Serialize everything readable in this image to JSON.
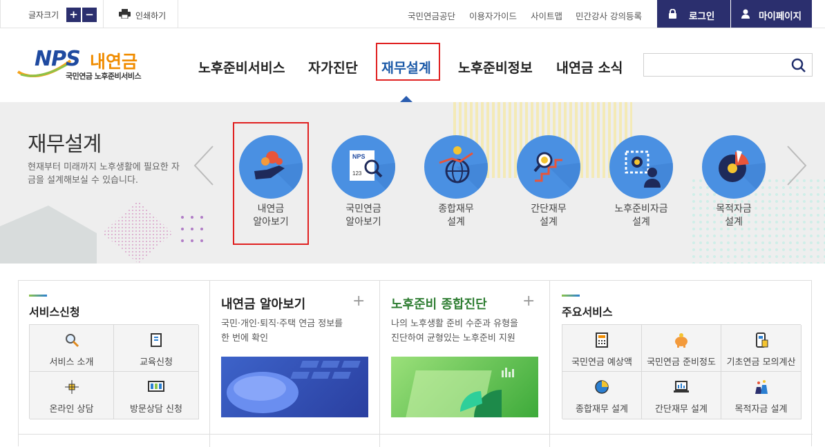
{
  "utility": {
    "font_size_label": "글자크기",
    "plus": "+",
    "minus": "−",
    "print_label": "인쇄하기",
    "links": [
      "국민연금공단",
      "이용자가이드",
      "사이트맵",
      "민간강사 강의등록"
    ],
    "login": "로그인",
    "mypage": "마이페이지"
  },
  "header": {
    "logo_main": "NPS",
    "logo_sub": "내연금",
    "logo_caption": "국민연금 노후준비서비스",
    "nav": [
      "노후준비서비스",
      "자가진단",
      "재무설계",
      "노후준비정보",
      "내연금 소식"
    ],
    "active_index": 2,
    "search_placeholder": ""
  },
  "banner": {
    "title": "재무설계",
    "desc": "현재부터 미래까지 노후생활에 필요한 자금을 설계해보실 수 있습니다.",
    "items": [
      {
        "line1": "내연금",
        "line2": "알아보기",
        "icon": "hand-coin-icon"
      },
      {
        "line1": "국민연금",
        "line2": "알아보기",
        "icon": "nps-document-search-icon"
      },
      {
        "line1": "종합재무",
        "line2": "설계",
        "icon": "globe-chart-icon"
      },
      {
        "line1": "간단재무",
        "line2": "설계",
        "icon": "magnifier-stairs-icon"
      },
      {
        "line1": "노후준비자금",
        "line2": "설계",
        "icon": "person-gear-icon"
      },
      {
        "line1": "목적자금",
        "line2": "설계",
        "icon": "pie-chart-coin-icon"
      }
    ]
  },
  "service_apply": {
    "title": "서비스신청",
    "items": [
      "서비스 소개",
      "교육신청",
      "온라인 상담",
      "방문상담 신청"
    ]
  },
  "my_pension": {
    "title": "내연금 알아보기",
    "desc_line1": "국민·개인·퇴직·주택 연금 정보를",
    "desc_line2": "한 번에 확인",
    "plus": "+"
  },
  "diagnosis": {
    "title": "노후준비 종합진단",
    "desc_line1": "나의 노후생활 준비 수준과 유형을",
    "desc_line2": "진단하여 균형있는 노후준비 지원",
    "plus": "+"
  },
  "main_services": {
    "title": "주요서비스",
    "items": [
      "국민연금 예상액",
      "국민연금 준비정도",
      "기초연금 모의계산",
      "종합재무 설계",
      "간단재무 설계",
      "목적자금 설계"
    ]
  },
  "colors": {
    "navy": "#2b2f6e",
    "blue": "#4a90e2",
    "active": "#1c5aa8",
    "green": "#2e7d32",
    "highlight": "#e02020"
  }
}
